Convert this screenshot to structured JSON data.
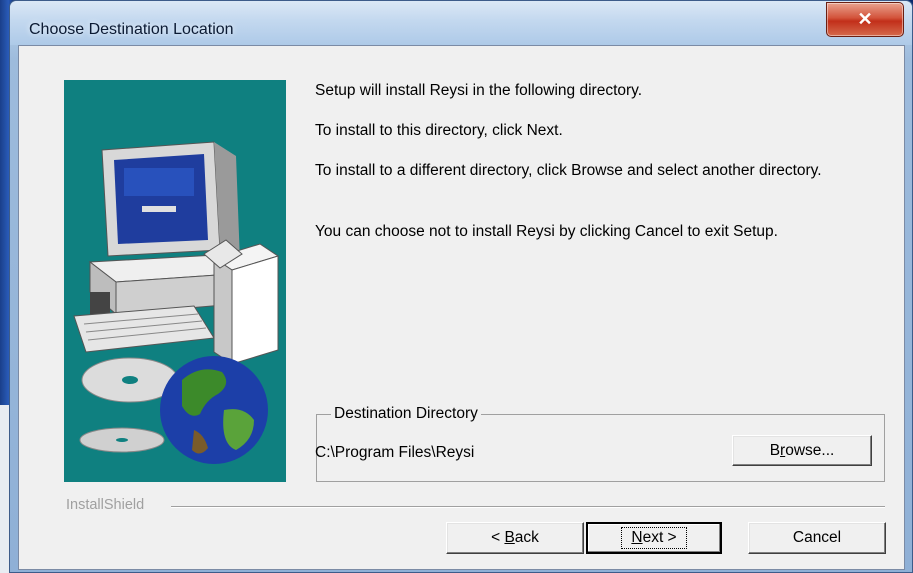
{
  "window": {
    "title": "Choose Destination Location",
    "close_symbol": "✕"
  },
  "body": {
    "line1": "Setup will install Reysi in the following directory.",
    "line2": "To install to this directory, click Next.",
    "line3": "To install to a different directory, click Browse and select another directory.",
    "line4": "You can choose not to install Reysi by clicking Cancel to exit Setup."
  },
  "destination": {
    "group_label": "Destination Directory",
    "path": "C:\\Program Files\\Reysi",
    "browse_pre": "B",
    "browse_key": "r",
    "browse_post": "owse..."
  },
  "footer": {
    "brand": "InstallShield",
    "back_pre": "< ",
    "back_key": "B",
    "back_post": "ack",
    "next_key": "N",
    "next_post": "ext >",
    "cancel": "Cancel"
  },
  "icons": {
    "art": "computer-cd-globe-illustration",
    "close": "close-icon"
  },
  "colors": {
    "art_background": "#0f8080",
    "close_button": "#c8432b",
    "dialog_background": "#f0f0f0"
  }
}
